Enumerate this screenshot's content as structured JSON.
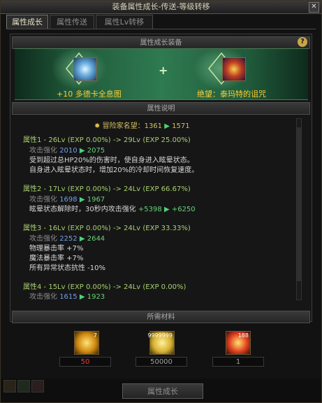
{
  "window": {
    "title": "装备属性成长-传送-等级转移",
    "close_icon": "close-icon"
  },
  "tabs": [
    {
      "label": "属性成长",
      "active": true
    },
    {
      "label": "属性传送",
      "active": false
    },
    {
      "label": "属性Lv转移",
      "active": false
    }
  ],
  "equip": {
    "header": "属性成长装备",
    "left_item": {
      "name": "+10  多德卡全息图"
    },
    "right_item": {
      "name": "绝望：泰玛特的诅咒"
    },
    "plus": "+"
  },
  "desc": {
    "header": "属性说明",
    "fame": {
      "label": "冒险家名望：1361",
      "to": "1571"
    },
    "attrs": [
      {
        "level": "属性1 - 26Lv (EXP 0.00%) -> 29Lv (EXP 25.00%)",
        "stat_label": "攻击强化",
        "stat_from": "2010",
        "stat_to": "2075",
        "lines": [
          "受到超过总HP20%的伤害时，使自身进入眩晕状态。",
          "自身进入眩晕状态时，增加20%的冷却时间恢复速度。"
        ]
      },
      {
        "level": "属性2 - 17Lv (EXP 0.00%) -> 24Lv (EXP 66.67%)",
        "stat_label": "攻击强化",
        "stat_from": "1698",
        "stat_to": "1967",
        "lines": [
          "眩晕状态解除时，30秒内攻击强化"
        ],
        "extra_from": "+5398",
        "extra_to": "+6250"
      },
      {
        "level": "属性3 - 16Lv (EXP 0.00%) -> 24Lv (EXP 33.33%)",
        "stat_label": "攻击强化",
        "stat_from": "2252",
        "stat_to": "2644",
        "lines": [
          "物理暴击率 +7%",
          "魔法暴击率 +7%",
          "所有异常状态抗性 -10%"
        ]
      },
      {
        "level": "属性4 - 15Lv (EXP 0.00%) -> 24Lv (EXP 0.00%)",
        "stat_label": "攻击强化",
        "stat_from": "1615",
        "stat_to": "1923",
        "lines": []
      }
    ]
  },
  "materials": {
    "header": "所需材料",
    "items": [
      {
        "icon": "gold-crystal-icon",
        "badge": "7",
        "count": "50",
        "count_color": "#e04040"
      },
      {
        "icon": "gold-coins-icon",
        "badge": "9999999",
        "count": "50000",
        "count_color": "#a0a0a0"
      },
      {
        "icon": "red-burst-icon",
        "badge": "188",
        "count": "1",
        "count_color": "#a0a0a0"
      }
    ]
  },
  "button": {
    "grow": "属性成长"
  },
  "help": "?"
}
